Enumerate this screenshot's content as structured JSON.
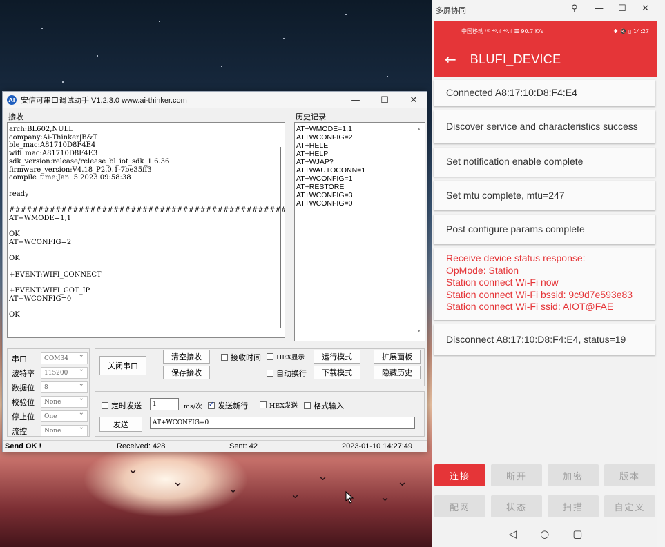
{
  "desktop": {
    "cursor": "mouse-pointer"
  },
  "serial_tool": {
    "title": "安信可串口调试助手 V1.2.3.0   www.ai-thinker.com",
    "icon": "ai-thinker-logo",
    "controls": {
      "minimize": "—",
      "maximize": "☐",
      "close": "✕"
    },
    "receive_label": "接收",
    "history_label": "历史记录",
    "receive_text": "arch:BL602,NULL\ncompany:Ai-Thinker|B&T\nble_mac:A81710D8F4E4\nwifi_mac:A81710D8F4E3\nsdk_version:release/release_bl_iot_sdk_1.6.36\nfirmware_version:V4.18_P2.0.1-7be35ff3\ncompile_time:Jan  5 2023 09:58:38\n\nready\n\n#################################################\nAT+WMODE=1,1\n\nOK\nAT+WCONFIG=2\n\nOK\n\n+EVENT:WIFI_CONNECT\n\n+EVENT:WIFI_GOT_IP\nAT+WCONFIG=0\n\nOK",
    "history": [
      "AT+WMODE=1,1",
      "AT+WCONFIG=2",
      "AT+HELE",
      "AT+HELP",
      "AT+WJAP?",
      "AT+WAUTOCONN=1",
      "AT+WCONFIG=1",
      "AT+RESTORE",
      "AT+WCONFIG=3",
      "AT+WCONFIG=0"
    ],
    "params": [
      {
        "label": "串口",
        "value": "COM34"
      },
      {
        "label": "波特率",
        "value": "115200"
      },
      {
        "label": "数据位",
        "value": "8"
      },
      {
        "label": "校验位",
        "value": "None"
      },
      {
        "label": "停止位",
        "value": "One"
      },
      {
        "label": "流控",
        "value": "None"
      }
    ],
    "buttons": {
      "close_port": "关闭串口",
      "clear_recv": "清空接收",
      "save_recv": "保存接收",
      "run_mode": "运行模式",
      "download_mode": "下载模式",
      "expand_panel": "扩展面板",
      "hide_history": "隐藏历史",
      "send": "发送"
    },
    "checks": {
      "recv_time": "接收时间",
      "hex_display": "HEX显示",
      "auto_wrap": "自动换行",
      "timed_send": "定时发送",
      "send_newline": "发送新行",
      "hex_send": "HEX发送",
      "format_input": "格式输入"
    },
    "interval_value": "1",
    "interval_unit": "ms/次",
    "send_input": "AT+WCONFIG=0",
    "status": {
      "state": "Send OK !",
      "received": "Received: 428",
      "sent": "Sent: 42",
      "time": "2023-01-10 14:27:49"
    }
  },
  "phone_window": {
    "title": "多屏协同",
    "controls": {
      "pin": "⚲",
      "minimize": "—",
      "maximize": "☐",
      "close": "✕"
    },
    "status_left": "中国移动 ᴴᴰ ⁴⁶.ıl ⁴⁶.ıl ☰ 90.7 K/s",
    "status_right": "✱ 🔇 ▯ 14:27",
    "app_title": "BLUFI_DEVICE",
    "back_icon": "←",
    "messages": [
      {
        "text": "Connected A8:17:10:D8:F4:E4",
        "error": false
      },
      {
        "text": "Discover service and characteristics success",
        "error": false
      },
      {
        "text": "Set notification enable  complete",
        "error": false
      },
      {
        "text": "Set mtu complete, mtu=247",
        "error": false
      },
      {
        "text": "Post configure params complete",
        "error": false
      },
      {
        "text": "Receive device status response:\nOpMode: Station\nStation connect Wi-Fi now\nStation connect Wi-Fi bssid: 9c9d7e593e83\nStation connect Wi-Fi ssid: AIOT@FAE",
        "error": true
      },
      {
        "text": "Disconnect A8:17:10:D8:F4:E4, status=19",
        "error": false
      }
    ],
    "buttons_row1": [
      "连接",
      "断开",
      "加密",
      "版本"
    ],
    "buttons_row2": [
      "配网",
      "状态",
      "扫描",
      "自定义"
    ],
    "nav": {
      "back": "◁",
      "home": "○",
      "recent": "▢"
    },
    "accent_color": "#e53538"
  }
}
